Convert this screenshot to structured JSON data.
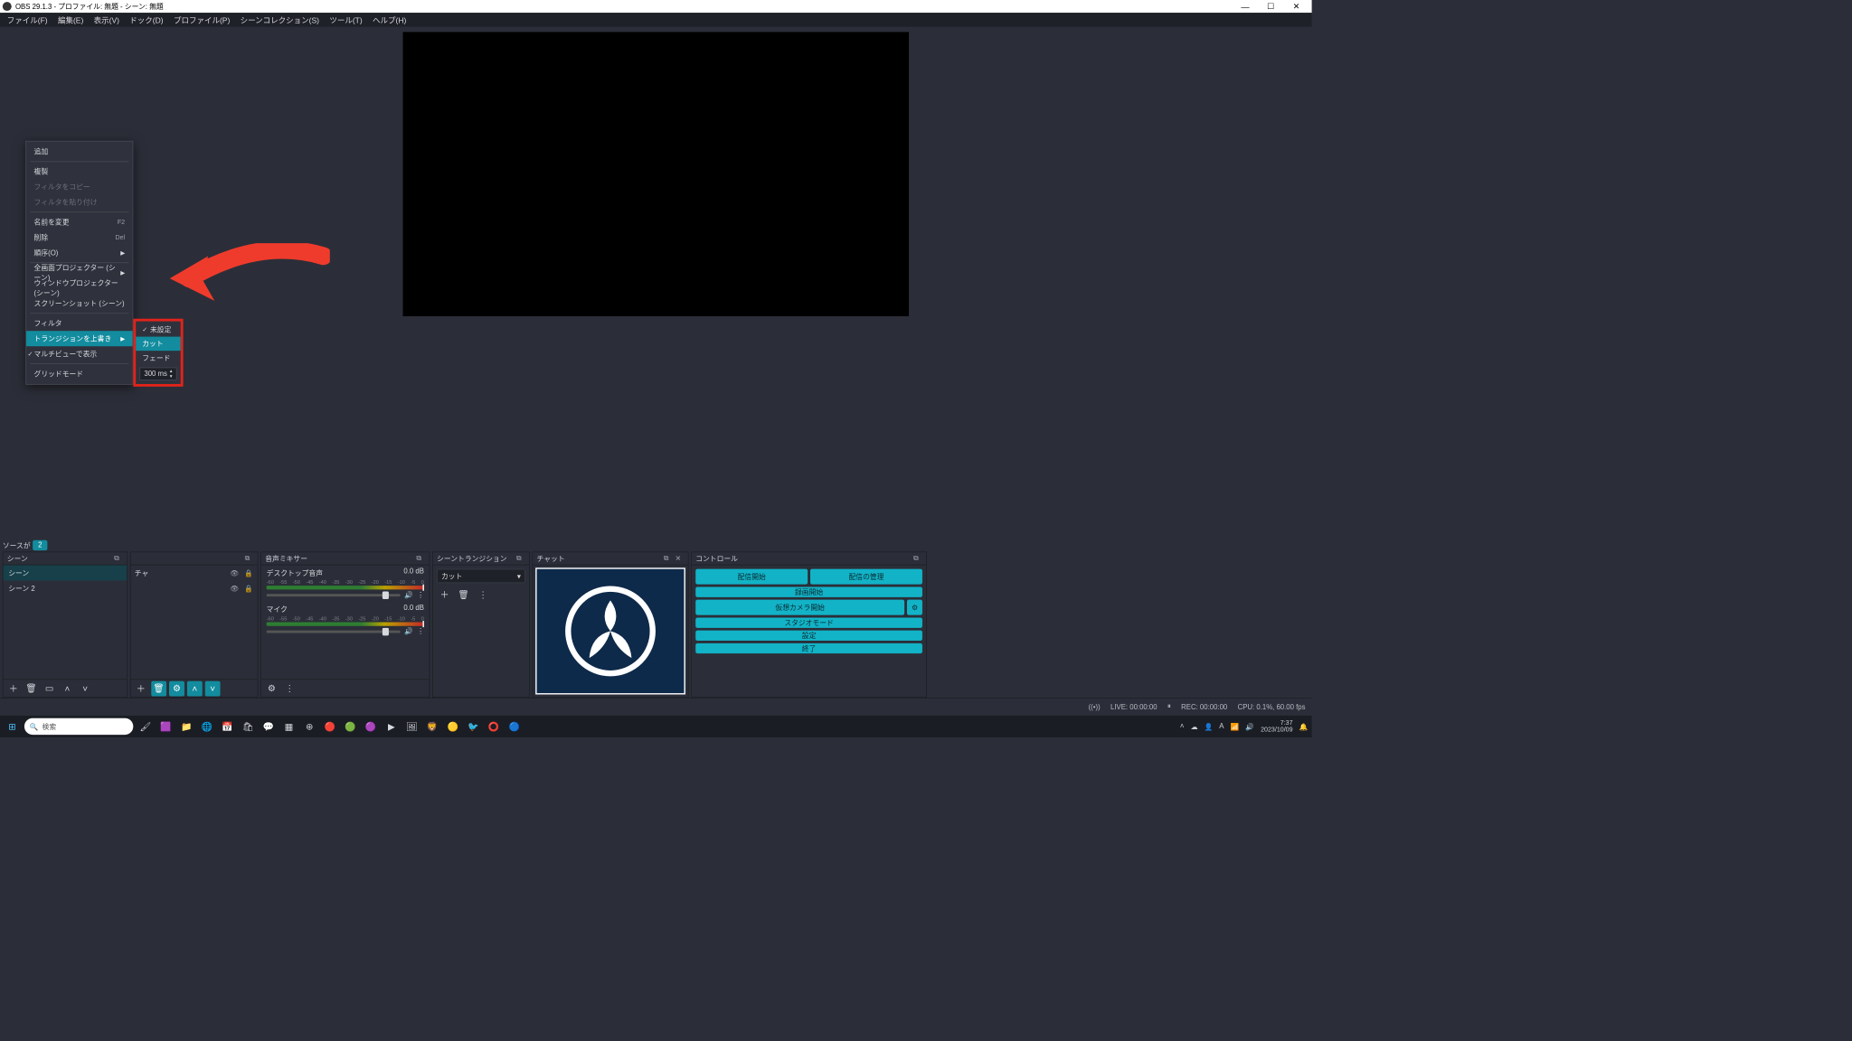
{
  "title": "OBS 29.1.3 - プロファイル: 無題 - シーン: 無題",
  "menu": [
    "ファイル(F)",
    "編集(E)",
    "表示(V)",
    "ドック(D)",
    "プロファイル(P)",
    "シーンコレクション(S)",
    "ツール(T)",
    "ヘルプ(H)"
  ],
  "panels": {
    "scenes": "シーン",
    "sources": "ソースが",
    "mixer": "音声ミキサー",
    "transitions": "シーントランジション",
    "chat": "チャット",
    "controls": "コントロール"
  },
  "scenes": {
    "items": [
      "シーン",
      "シーン 2"
    ],
    "selected": 0
  },
  "sources": {
    "items": [
      "チャ"
    ],
    "pill": "2"
  },
  "mixer": {
    "ch": [
      {
        "name": "デスクトップ音声",
        "db": "0.0 dB"
      },
      {
        "name": "マイク",
        "db": "0.0 dB"
      }
    ],
    "scale": [
      "-60",
      "-55",
      "-50",
      "-45",
      "-40",
      "-35",
      "-30",
      "-25",
      "-20",
      "-15",
      "-10",
      "-5",
      "0"
    ]
  },
  "transitions": {
    "selected": "カット"
  },
  "controls": {
    "start_stream": "配信開始",
    "manage_stream": "配信の管理",
    "start_record": "録画開始",
    "start_vcam": "仮想カメラ開始",
    "studio": "スタジオモード",
    "settings": "設定",
    "exit": "終了"
  },
  "status": {
    "live": "LIVE: 00:00:00",
    "rec": "REC: 00:00:00",
    "cpu": "CPU: 0.1%, 60.00 fps"
  },
  "ctx": {
    "add": "追加",
    "dup": "複製",
    "copy_f": "フィルタをコピー",
    "paste_f": "フィルタを貼り付け",
    "rename": "名前を変更",
    "rename_sc": "F2",
    "delete": "削除",
    "delete_sc": "Del",
    "order": "順序(O)",
    "fproj": "全画面プロジェクター (シーン)",
    "wproj": "ウィンドウプロジェクター (シーン)",
    "sshot": "スクリーンショット (シーン)",
    "filters": "フィルタ",
    "ovtrans": "トランジションを上書き",
    "mview": "マルチビューで表示",
    "grid": "グリッドモード"
  },
  "sub": {
    "unset": "未設定",
    "cut": "カット",
    "fade": "フェード",
    "dur": "300 ms"
  },
  "taskbar": {
    "search": "検索",
    "time": "7:37",
    "date": "2023/10/09"
  }
}
